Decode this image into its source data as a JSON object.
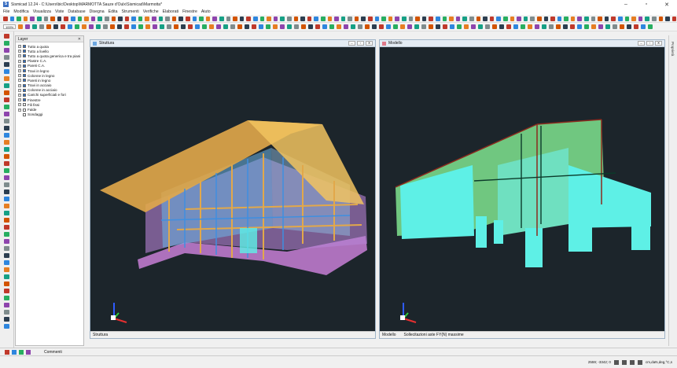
{
  "window": {
    "title": "Sismicad 12.24 - C:\\Users\\bic\\Desktop\\MARMOTTA Sauze d'Oulx\\Sismicad\\Marmotta*",
    "app_icon": "S"
  },
  "menu": [
    "File",
    "Modifica",
    "Visualizza",
    "Viste",
    "Database",
    "Disegna",
    "Edita",
    "Strumenti",
    "Verifiche",
    "Elaborati",
    "Finestre",
    "Aiuto"
  ],
  "toolbar": {
    "zoom": "100%"
  },
  "layers": {
    "title": "Layer",
    "items": [
      {
        "label": "Tutto a quota",
        "checked": true,
        "expand": "+"
      },
      {
        "label": "Tutto a livello",
        "checked": true,
        "expand": "+"
      },
      {
        "label": "Tutto a quota generica e tra piani",
        "checked": true,
        "expand": "+"
      },
      {
        "label": "Plastre C.A.",
        "checked": true,
        "expand": "+"
      },
      {
        "label": "Pareti C.A.",
        "checked": true,
        "expand": "+"
      },
      {
        "label": "Travi in legno",
        "checked": true,
        "expand": "+"
      },
      {
        "label": "Colonne in legno",
        "checked": true,
        "expand": "+"
      },
      {
        "label": "Pareti in legno",
        "checked": true,
        "expand": "+"
      },
      {
        "label": "Travi in acciaio",
        "checked": true,
        "expand": "+"
      },
      {
        "label": "Colonne in acciaio",
        "checked": true,
        "expand": "+"
      },
      {
        "label": "Carichi superficiali e fori",
        "checked": true,
        "expand": "+"
      },
      {
        "label": "Finestre",
        "checked": true,
        "expand": "+"
      },
      {
        "label": "Fili fissi",
        "checked": false,
        "expand": "+"
      },
      {
        "label": "Falde",
        "checked": false,
        "expand": "+"
      },
      {
        "label": "Sondaggi",
        "checked": false,
        "expand": ""
      }
    ]
  },
  "left_window": {
    "title": "Struttura",
    "footer": "Struttura"
  },
  "right_window": {
    "title": "Modello",
    "footer_label": "Modello",
    "footer_text": "Sollecitazioni aste FY(N) massime"
  },
  "right_panel": {
    "label": "Proprietà"
  },
  "bottom": {
    "comment_label": "Commenti"
  },
  "status": {
    "coords": "2559; -3342; 0",
    "units": "cm,daN,deg,°C,s"
  },
  "colors": {
    "canvas": "#1c252b",
    "timber": "#e2a84a",
    "steel": "#4aa3e0",
    "concrete": "#c77fd6",
    "model_green": "#7ad98a",
    "model_cyan": "#5ef0e6"
  }
}
